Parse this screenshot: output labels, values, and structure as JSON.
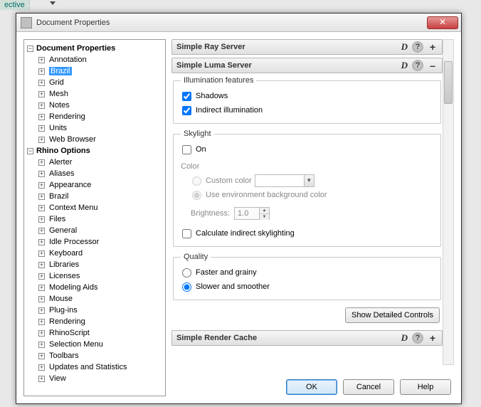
{
  "bg": {
    "menu_item": "ective"
  },
  "dialog": {
    "title": "Document Properties",
    "close_glyph": "✕"
  },
  "tree": {
    "root1": {
      "label": "Document Properties",
      "expanded": true
    },
    "doc_children": [
      "Annotation",
      "Brazil",
      "Grid",
      "Mesh",
      "Notes",
      "Rendering",
      "Units",
      "Web Browser"
    ],
    "doc_selected_index": 1,
    "root2": {
      "label": "Rhino Options",
      "expanded": true
    },
    "rhino_children": [
      "Alerter",
      "Aliases",
      "Appearance",
      "Brazil",
      "Context Menu",
      "Files",
      "General",
      "Idle Processor",
      "Keyboard",
      "Libraries",
      "Licenses",
      "Modeling Aids",
      "Mouse",
      "Plug-ins",
      "Rendering",
      "RhinoScript",
      "Selection Menu",
      "Toolbars",
      "Updates and Statistics",
      "View"
    ]
  },
  "sections": {
    "ray": {
      "title": "Simple Ray Server",
      "d": "D",
      "toggle": "+"
    },
    "luma": {
      "title": "Simple Luma Server",
      "d": "D",
      "toggle": "–"
    },
    "cache": {
      "title": "Simple Render Cache",
      "d": "D",
      "toggle": "+"
    }
  },
  "illum": {
    "legend": "Illumination features",
    "shadows_label": "Shadows",
    "indirect_label": "Indirect illumination",
    "shadows_checked": true,
    "indirect_checked": true
  },
  "skylight": {
    "legend": "Skylight",
    "on_label": "On",
    "on_checked": false,
    "color_label": "Color",
    "custom_label": "Custom color",
    "env_label": "Use environment background color",
    "brightness_label": "Brightness:",
    "brightness_value": "1.0",
    "calc_label": "Calculate indirect skylighting",
    "calc_checked": false
  },
  "quality": {
    "legend": "Quality",
    "faster_label": "Faster and grainy",
    "slower_label": "Slower and smoother",
    "selected": "slower"
  },
  "detailed_btn": "Show Detailed Controls",
  "buttons": {
    "ok": "OK",
    "cancel": "Cancel",
    "help": "Help"
  }
}
